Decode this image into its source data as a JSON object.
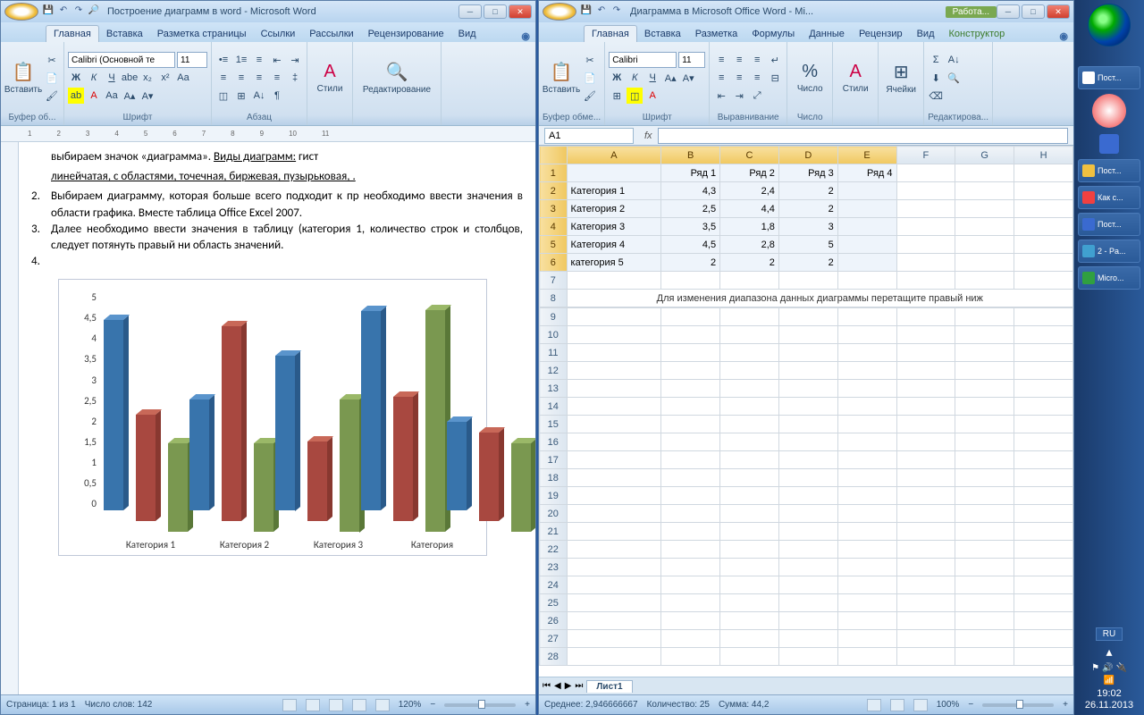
{
  "word": {
    "qat": {
      "save": "💾",
      "undo": "↶",
      "redo": "↷",
      "print": "🔎"
    },
    "title": "Построение диаграмм в word - Microsoft Word",
    "tabs": [
      "Главная",
      "Вставка",
      "Разметка страницы",
      "Ссылки",
      "Рассылки",
      "Рецензирование",
      "Вид"
    ],
    "ribbon": {
      "paste": "Вставить",
      "clipboard": "Буфер об...",
      "fontName": "Calibri (Основной те",
      "fontSize": "11",
      "fontGroup": "Шрифт",
      "paraGroup": "Абзац",
      "stylesBtn": "Стили",
      "stylesGroup": " ",
      "editBtn": "Редактирование",
      "findIco": "🔍"
    },
    "doc": {
      "p1a": "выбираем значок «диаграмма». ",
      "p1u": "Виды диаграмм:",
      "p1b": " гист",
      "p1c": "линейчатая, с областями, точечная, биржевая, пузырьковая, .",
      "i2": "Выбираем диаграмму, которая больше всего подходит к пр необходимо ввести значения в области графика. Вместе таблица Office Excel 2007.",
      "i3": "Далее необходимо ввести значения в таблицу (категория 1, количество строк и столбцов, следует потянуть правый ни область значений.",
      "n2": "2.",
      "n3": "3.",
      "n4": "4."
    },
    "status": {
      "page": "Страница: 1 из 1",
      "words": "Число слов: 142",
      "zoom": "120%"
    }
  },
  "excel": {
    "title": "Диаграмма в Microsoft Office Word - Mi...",
    "context": "Работа...",
    "tabs": [
      "Главная",
      "Вставка",
      "Разметка",
      "Формулы",
      "Данные",
      "Рецензир",
      "Вид",
      "Конструктор"
    ],
    "ribbon": {
      "paste": "Вставить",
      "clipboard": "Буфер обме...",
      "fontName": "Calibri",
      "fontSize": "11",
      "fontGroup": "Шрифт",
      "alignGroup": "Выравнивание",
      "numberGroup": "Число",
      "numberBtn": "Число",
      "stylesBtn": "Стили",
      "cellsBtn": "Ячейки",
      "editGroup": "Редактирова..."
    },
    "namebox": "A1",
    "fx": "fx",
    "cols": [
      "A",
      "B",
      "C",
      "D",
      "E",
      "F",
      "G",
      "H"
    ],
    "headers": [
      "",
      "Ряд 1",
      "Ряд 2",
      "Ряд 3",
      "Ряд 4"
    ],
    "rows": [
      {
        "cat": "Категория 1",
        "v": [
          "4,3",
          "2,4",
          "2",
          ""
        ]
      },
      {
        "cat": "Категория 2",
        "v": [
          "2,5",
          "4,4",
          "2",
          ""
        ]
      },
      {
        "cat": "Категория 3",
        "v": [
          "3,5",
          "1,8",
          "3",
          ""
        ]
      },
      {
        "cat": "Категория 4",
        "v": [
          "4,5",
          "2,8",
          "5",
          ""
        ]
      },
      {
        "cat": "категория 5",
        "v": [
          "2",
          "2",
          "2",
          ""
        ]
      }
    ],
    "hint": "Для изменения диапазона данных диаграммы перетащите правый ниж",
    "sheetTab": "Лист1",
    "status": {
      "avg": "Среднее: 2,946666667",
      "count": "Количество: 25",
      "sum": "Сумма: 44,2",
      "zoom": "100%"
    }
  },
  "taskbar": {
    "items": [
      {
        "ico": "#d04030",
        "label": "Пост..."
      },
      {
        "ico": "#d04030",
        "label": "Как с..."
      },
      {
        "ico": "#2a5ad0",
        "label": "Пост..."
      },
      {
        "ico": "#40a0d0",
        "label": "2 - Pa..."
      },
      {
        "ico": "#30a040",
        "label": "Micro..."
      }
    ],
    "lang": "RU",
    "time": "19:02",
    "date": "26.11.2013"
  },
  "chart_data": {
    "type": "bar",
    "subtype": "3d-clustered",
    "categories": [
      "Категория 1",
      "Категория 2",
      "Категория 3",
      "Категория 4",
      "категория 5"
    ],
    "series": [
      {
        "name": "Ряд 1",
        "color": "#3874ac",
        "values": [
          4.3,
          2.5,
          3.5,
          4.5,
          2
        ]
      },
      {
        "name": "Ряд 2",
        "color": "#a84840",
        "values": [
          2.4,
          4.4,
          1.8,
          2.8,
          2
        ]
      },
      {
        "name": "Ряд 3",
        "color": "#7a9850",
        "values": [
          2,
          2,
          3,
          5,
          2
        ]
      }
    ],
    "ylim": [
      0,
      5
    ],
    "ystep": 0.5,
    "yticks": [
      "5",
      "4,5",
      "4",
      "3,5",
      "3",
      "2,5",
      "2",
      "1,5",
      "1",
      "0,5",
      "0"
    ],
    "xlabels": [
      "Категория 1",
      "Категория 2",
      "Категория 3",
      "Категория"
    ]
  }
}
